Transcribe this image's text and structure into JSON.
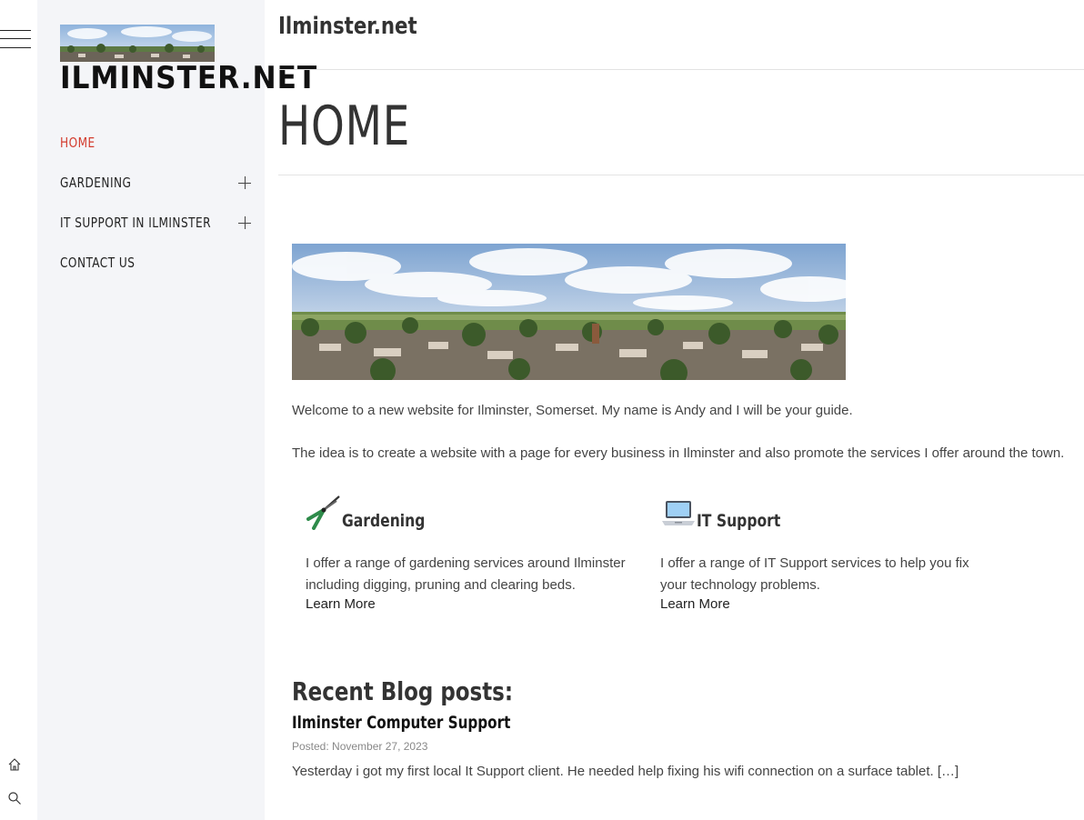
{
  "rail": {
    "menu_icon": "hamburger-menu-icon",
    "home_icon": "home-icon",
    "search_icon": "search-icon"
  },
  "sidebar": {
    "logo_alt": "Ilminster panorama",
    "site_title": "ILMINSTER.NET",
    "nav": [
      {
        "label": "HOME",
        "active": true,
        "expandable": false
      },
      {
        "label": "GARDENING",
        "active": false,
        "expandable": true
      },
      {
        "label": "IT SUPPORT IN ILMINSTER",
        "active": false,
        "expandable": true
      },
      {
        "label": "CONTACT US",
        "active": false,
        "expandable": false
      }
    ]
  },
  "header": {
    "title": "Ilminster.net"
  },
  "page": {
    "title": "HOME",
    "intro": "Welcome to a new website for Ilminster, Somerset. My name is Andy and I will be your guide.",
    "idea": "The idea is to create a website with a page for every business in Ilminster and also promote the services I offer around the town."
  },
  "services": [
    {
      "icon": "pruning-shears-icon",
      "heading": "Gardening",
      "text": "I offer a range of gardening services around Ilminster including digging, pruning and clearing beds.",
      "link": "Learn More"
    },
    {
      "icon": "laptop-icon",
      "heading": "IT Support",
      "text": "I offer a range of IT Support services to help you fix your technology problems.",
      "link": "Learn More"
    }
  ],
  "blog": {
    "heading": "Recent Blog posts:",
    "posts": [
      {
        "title": "Ilminster Computer Support",
        "date": "Posted: November 27, 2023",
        "excerpt": "Yesterday i got my first local It Support client. He needed help fixing his wifi connection on a surface tablet. […]"
      }
    ]
  },
  "colors": {
    "accent": "#d33c2e",
    "sidebar_bg": "#f4f5f8",
    "text": "#333333"
  }
}
